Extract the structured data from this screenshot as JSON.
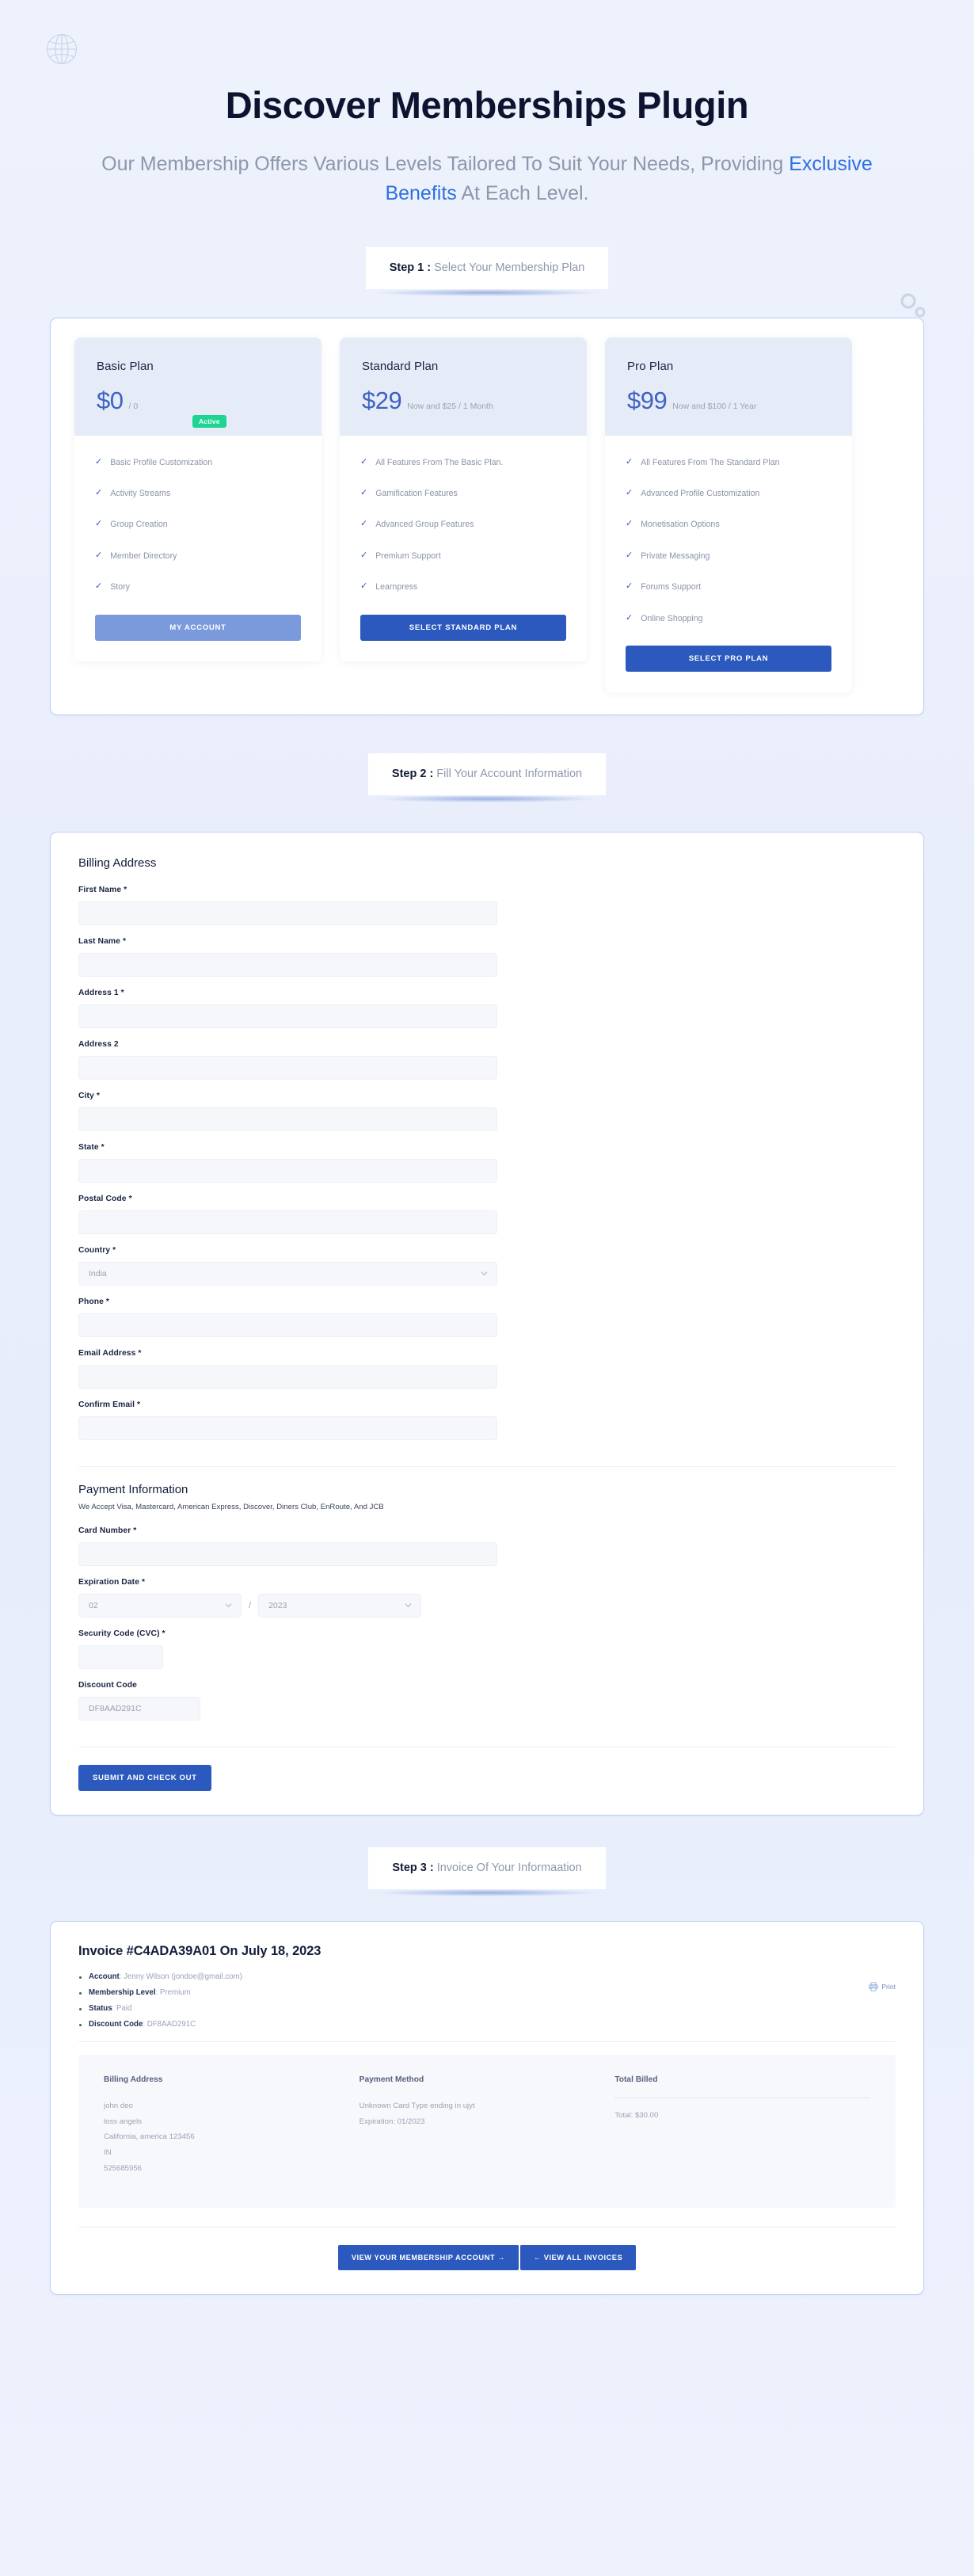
{
  "hero": {
    "title": "Discover Memberships Plugin",
    "subtitle_part1": "Our Membership Offers Various Levels Tailored To Suit Your Needs, Providing ",
    "subtitle_highlight": "Exclusive Benefits",
    "subtitle_part2": " At Each Level.",
    "highlight_color": "#2e6fe0"
  },
  "steps": {
    "step1_num": "Step 1 :",
    "step1_text": " Select Your Membership Plan",
    "step2_num": "Step 2 :",
    "step2_text": " Fill Your Account Information",
    "step3_num": "Step 3 :",
    "step3_text": " Invoice Of Your Informaation"
  },
  "plans": [
    {
      "name": "Basic Plan",
      "price": "$0",
      "period": "/ 0",
      "badge": "Active",
      "features": [
        "Basic Profile Customization",
        "Activity Streams",
        "Group Creation",
        "Member Directory",
        "Story"
      ],
      "button": "MY ACCOUNT",
      "button_style": "muted"
    },
    {
      "name": "Standard Plan",
      "price": "$29",
      "period": "Now and $25 / 1 Month",
      "badge": "",
      "features": [
        "All Features From The Basic Plan.",
        "Gamification Features",
        "Advanced Group Features",
        "Premium Support",
        "Learnpress"
      ],
      "button": "SELECT STANDARD PLAN",
      "button_style": "primary"
    },
    {
      "name": "Pro Plan",
      "price": "$99",
      "period": "Now and $100 / 1 Year",
      "badge": "",
      "features": [
        "All Features From The Standard Plan",
        "Advanced Profile Customization",
        "Monetisation Options",
        "Private Messaging",
        "Forums Support",
        "Online Shopping"
      ],
      "button": "SELECT PRO PLAN",
      "button_style": "primary"
    }
  ],
  "billing": {
    "section_title": "Billing Address",
    "first_name_label": "First Name *",
    "last_name_label": "Last Name *",
    "address1_label": "Address 1 *",
    "address2_label": "Address 2",
    "city_label": "City *",
    "state_label": "State *",
    "postal_label": "Postal Code *",
    "country_label": "Country *",
    "country_value": "India",
    "phone_label": "Phone *",
    "email_label": "Email Address *",
    "confirm_email_label": "Confirm Email *",
    "first_name_value": "",
    "last_name_value": "",
    "address1_value": "",
    "address2_value": "",
    "city_value": "",
    "state_value": "",
    "postal_value": "",
    "phone_value": "",
    "email_value": "",
    "confirm_email_value": ""
  },
  "payment": {
    "section_title": "Payment Information",
    "accepted_note": "We Accept Visa, Mastercard, American Express, Discover, Diners Club, EnRoute, And JCB",
    "card_number_label": "Card Number *",
    "card_number_value": "",
    "expiration_label": "Expiration Date *",
    "expiration_month": "02",
    "expiration_separator": "/",
    "expiration_year": "2023",
    "cvc_label": "Security Code (CVC) *",
    "cvc_value": "",
    "discount_label": "Discount Code",
    "discount_value": "DF8AAD291C",
    "submit_button": "SUBMIT AND CHECK OUT"
  },
  "invoice": {
    "title": "Invoice #C4ADA39A01 On July 18, 2023",
    "print_label": "Print",
    "meta": [
      {
        "label": "Account",
        "value": "Jenny Wilson (jondoe@gmail.com)"
      },
      {
        "label": "Membership Level",
        "value": "Premium"
      },
      {
        "label": "Status",
        "value": "Paid"
      },
      {
        "label": "Discount Code",
        "value": "DF8AAD291C"
      }
    ],
    "billing_heading": "Billing Address",
    "billing_lines": [
      "john deo",
      "loss angels",
      "California, america 123456",
      "IN",
      "525685956"
    ],
    "payment_heading": "Payment Method",
    "payment_lines": [
      "Unknown Card Type ending in ujyt",
      "Expiration: 01/2023"
    ],
    "total_heading": "Total Billed",
    "total_value": "Total: $30.00",
    "view_account_button": "VIEW YOUR MEMBERSHIP ACCOUNT →",
    "view_invoices_button": "← VIEW ALL INVOICES"
  },
  "colors": {
    "accent": "#2b59bd",
    "muted_button": "#7b9adc",
    "active_badge": "#1ed492",
    "price": "#3f62c4"
  }
}
